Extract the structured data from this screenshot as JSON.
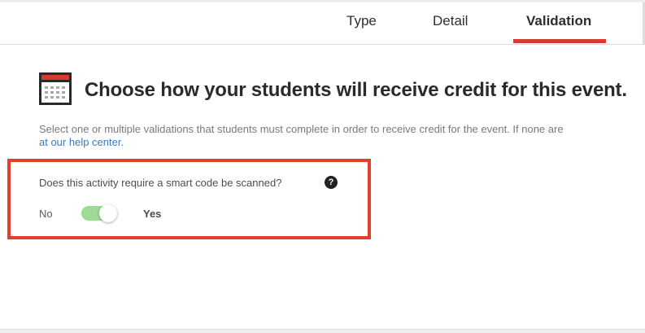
{
  "tabs": [
    {
      "label": "Type"
    },
    {
      "label": "Detail"
    },
    {
      "label": "Validation",
      "active": true
    }
  ],
  "accent_color": "#d63a30",
  "section": {
    "icon": "calendar-icon",
    "heading": "Choose how your students will receive credit for this event.",
    "description": "Select one or multiple validations that students must complete in order to receive credit for the event. If none are",
    "help_link": "at our help center."
  },
  "smart_code": {
    "question": "Does this activity require a smart code be scanned?",
    "help_icon": "question-circle-icon",
    "label_off": "No",
    "label_on": "Yes",
    "enabled": true,
    "toggle_color": "#9edc96"
  }
}
